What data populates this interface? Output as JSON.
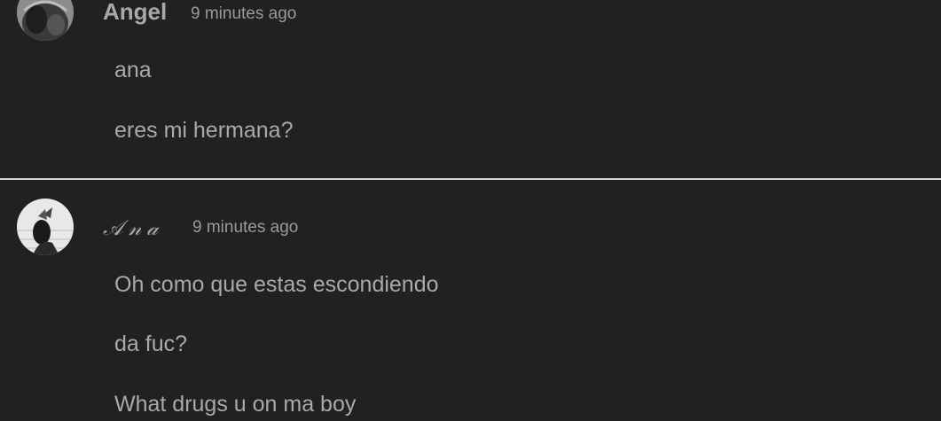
{
  "comments": [
    {
      "author": "Angel",
      "time": "9 minutes ago",
      "messages": [
        "ana",
        "eres mi hermana?"
      ]
    },
    {
      "author": "𝒜𝓃𝒶",
      "time": "9 minutes ago",
      "messages": [
        "Oh como que estas escondiendo",
        "da fuc?",
        "What drugs u on ma boy"
      ]
    }
  ]
}
